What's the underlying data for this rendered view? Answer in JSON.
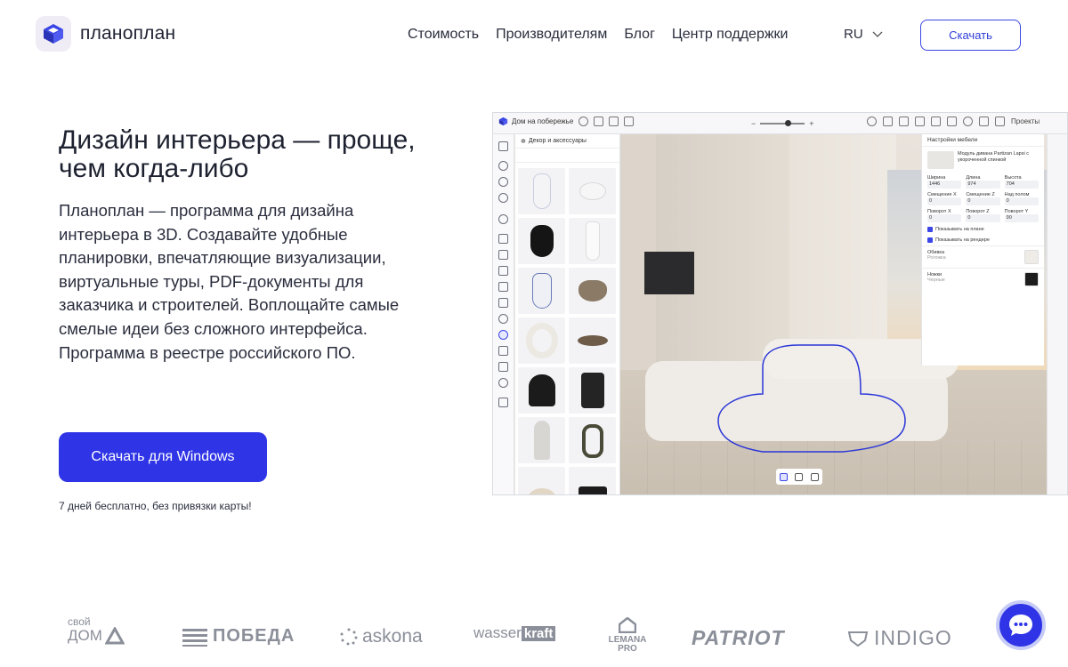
{
  "header": {
    "logo_text": "планоплан",
    "nav": [
      "Стоимость",
      "Производителям",
      "Блог",
      "Центр поддержки"
    ],
    "lang": "RU",
    "download_label": "Скачать"
  },
  "hero": {
    "title": "Дизайн интерьера — проще, чем когда-либо",
    "description": "Планоплан — программа для дизайна интерьера в 3D. Создавайте удобные планировки, впечатляющие визуализации, виртуальные туры, PDF-документы для заказчика и строителей. Воплощайте самые смелые идеи без сложного интерфейса. Программа в реестре российского ПО.",
    "cta_label": "Скачать для Windows",
    "cta_note": "7 дней бесплатно, без привязки карты!"
  },
  "app_preview": {
    "project_name": "Дом на побережье",
    "projects_label": "Проекты",
    "panel_title": "Декор и аксессуары",
    "settings_title": "Настройки мебели",
    "item_name": "Модуль дивана Partizan Lapsi с укороченной спинкой",
    "fields": [
      {
        "label": "Ширина",
        "value": "1446"
      },
      {
        "label": "Длина",
        "value": "974"
      },
      {
        "label": "Высота",
        "value": "704"
      },
      {
        "label": "Смещение X",
        "value": "0"
      },
      {
        "label": "Смещение Z",
        "value": "0"
      },
      {
        "label": "Над полом",
        "value": "0"
      },
      {
        "label": "Поворот X",
        "value": "0"
      },
      {
        "label": "Поворот Z",
        "value": "0"
      },
      {
        "label": "Поворот Y",
        "value": "90"
      }
    ],
    "checks": [
      "Показывать на плане",
      "Показывать на рендере"
    ],
    "materials": [
      {
        "name": "Обивка",
        "sub": "Рогожка"
      },
      {
        "name": "Ножки",
        "sub": "Черные"
      }
    ]
  },
  "brands": {
    "svoy_dom": [
      "свой",
      "ДОМ"
    ],
    "pobeda": "ПОБЕДА",
    "askona": "askona",
    "wasser": "wasser",
    "kraft": "kraft",
    "lemana": [
      "LEMANA",
      "PRO"
    ],
    "patriot": "PATRIOT",
    "indigo": "INDIGO"
  }
}
